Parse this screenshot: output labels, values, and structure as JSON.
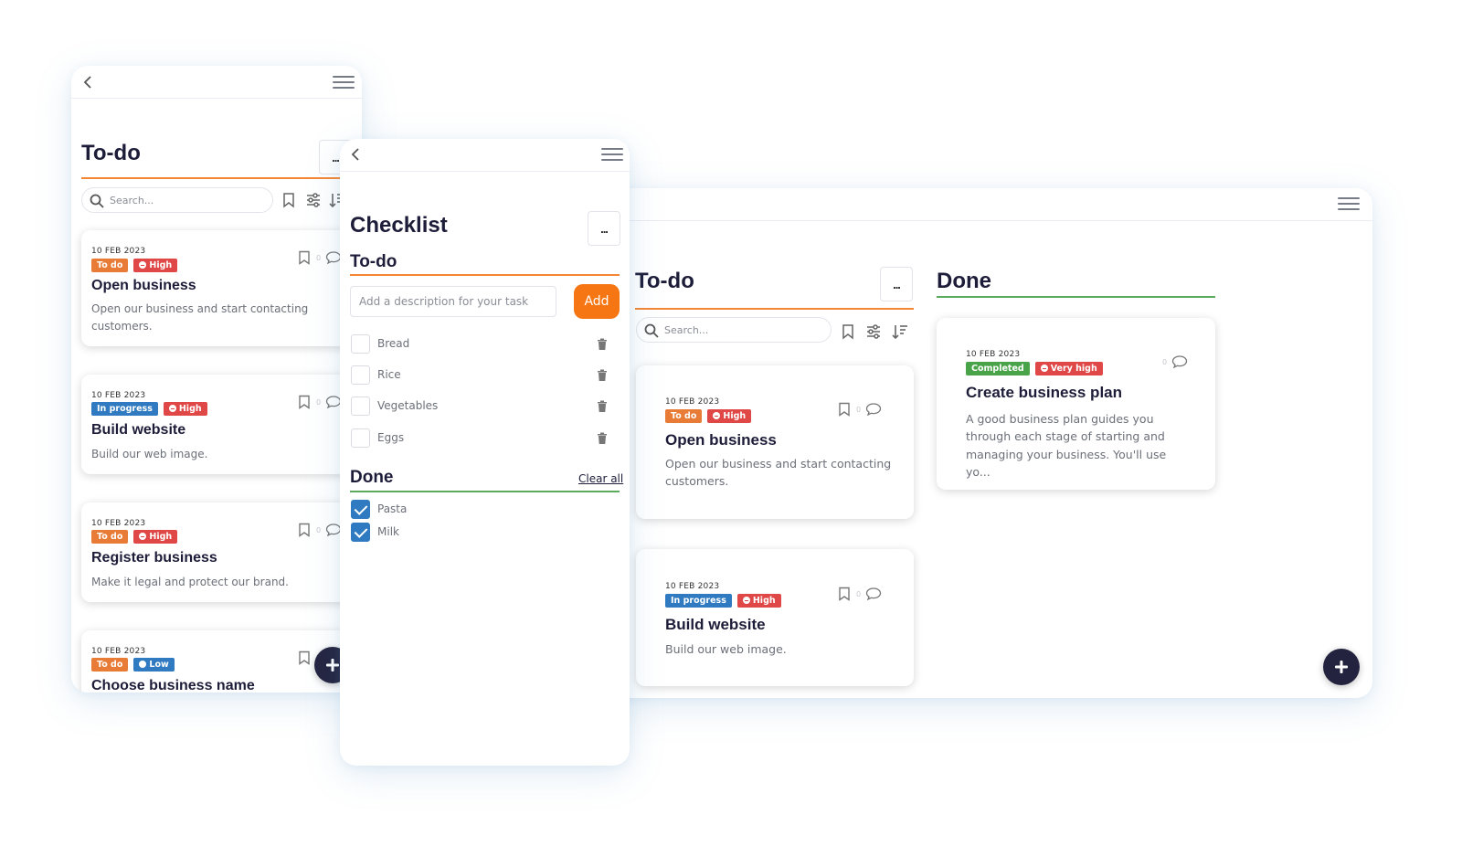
{
  "colors": {
    "accent_orange": "#f58634",
    "add_button": "#f57613",
    "done_green": "#5aab5b",
    "fab": "#23233f",
    "tag_todo": "#e87b35",
    "tag_in_progress": "#2f7ac0",
    "tag_high": "#e04848",
    "tag_completed": "#49a349"
  },
  "phone_left": {
    "title": "To-do",
    "more_label": "...",
    "search_placeholder": "Search...",
    "cards": [
      {
        "date": "10 FEB 2023",
        "status": "To do",
        "priority": "High",
        "comments": "0",
        "title": "Open business",
        "desc": "Open our business and start contacting customers."
      },
      {
        "date": "10 FEB 2023",
        "status": "In progress",
        "priority": "High",
        "comments": "0",
        "title": "Build website",
        "desc": "Build our web image."
      },
      {
        "date": "10 FEB 2023",
        "status": "To do",
        "priority": "High",
        "comments": "0",
        "title": "Register business",
        "desc": "Make it legal and protect our brand."
      },
      {
        "date": "10 FEB 2023",
        "status": "To do",
        "priority": "Low",
        "title": "Choose business name"
      }
    ]
  },
  "checklist": {
    "title": "Checklist",
    "more_label": "...",
    "todo_heading": "To-do",
    "input_placeholder": "Add a description for your task",
    "add_label": "Add",
    "todo_items": [
      "Bread",
      "Rice",
      "Vegetables",
      "Eggs"
    ],
    "done_heading": "Done",
    "clear_all": "Clear all",
    "done_items": [
      "Pasta",
      "Milk"
    ]
  },
  "desktop": {
    "todo_column": {
      "title": "To-do",
      "more_label": "...",
      "search_placeholder": "Search...",
      "cards": [
        {
          "date": "10 FEB 2023",
          "status": "To do",
          "priority": "High",
          "comments": "0",
          "title": "Open business",
          "desc": "Open our business and start contacting customers."
        },
        {
          "date": "10 FEB 2023",
          "status": "In progress",
          "priority": "High",
          "comments": "0",
          "title": "Build website",
          "desc": "Build our web image."
        }
      ]
    },
    "done_column": {
      "title": "Done",
      "cards": [
        {
          "date": "10 FEB 2023",
          "status": "Completed",
          "priority": "Very high",
          "comments": "0",
          "title": "Create business plan",
          "desc": "A good business plan guides you through each stage of starting and managing your business. You'll use yo..."
        }
      ]
    }
  }
}
